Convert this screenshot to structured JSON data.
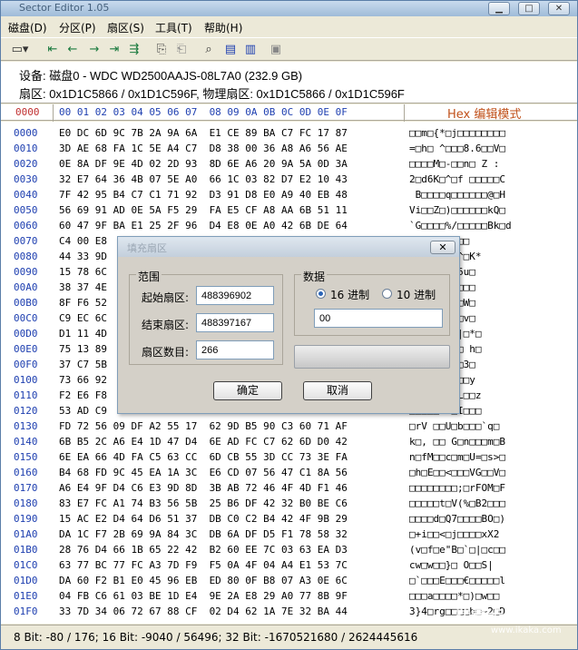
{
  "window": {
    "title": "Sector Editor 1.05",
    "min": "▁",
    "max": "□",
    "close": "✕"
  },
  "menu": [
    "磁盘(D)",
    "分区(P)",
    "扇区(S)",
    "工具(T)",
    "帮助(H)"
  ],
  "toolbar_icons": [
    "drive-icon",
    "first-icon",
    "prev-icon",
    "next-icon",
    "last-icon",
    "goto-icon",
    "copy-icon",
    "paste-icon",
    "search-icon",
    "fill-icon",
    "export-icon",
    "save-icon"
  ],
  "info": {
    "line1": "设备: 磁盘0 - WDC WD2500AAJS-08L7A0 (232.9 GB)",
    "line2": "扇区: 0x1D1C5866 / 0x1D1C596F,  物理扇区: 0x1D1C5866 / 0x1D1C596F"
  },
  "hex_header": {
    "offset": "0000",
    "cols": "00 01 02 03 04 05 06 07  08 09 0A 0B 0C 0D 0E 0F",
    "ascii_title": "Hex 编辑模式"
  },
  "offsets": [
    "0000",
    "0010",
    "0020",
    "0030",
    "0040",
    "0050",
    "0060",
    "0070",
    "0080",
    "0090",
    "00A0",
    "00B0",
    "00C0",
    "00D0",
    "00E0",
    "00F0",
    "0100",
    "0110",
    "0120",
    "0130",
    "0140",
    "0150",
    "0160",
    "0170",
    "0180",
    "0190",
    "01A0",
    "01B0",
    "01C0",
    "01D0",
    "01E0",
    "01F0"
  ],
  "hex_rows": [
    "E0 DC 6D 9C 7B 2A 9A 6A  E1 CE 89 BA C7 FC 17 87",
    "3D AE 68 FA 1C 5E A4 C7  D8 38 00 36 A8 A6 56 AE",
    "0E 8A DF 9E 4D 02 2D 93  8D 6E A6 20 9A 5A 0D 3A",
    "32 E7 64 36 4B 07 5E A0  66 1C 03 82 D7 E2 10 43",
    "7F 42 95 B4 C7 C1 71 92  D3 91 D8 E0 A9 40 EB 48",
    "56 69 91 AD 0E 5A F5 29  FA E5 CF A8 AA 6B 51 11",
    "60 47 9F BA E1 25 2F 96  D4 E8 0E A0 42 6B DE 64",
    "C4 00 E8",
    "44 33 9D",
    "15 78 6C",
    "38 37 4E",
    "8F F6 52",
    "C9 EC 6C",
    "D1 11 4D",
    "75 13 89",
    "37 C7 5B",
    "73 66 92",
    "F2 E6 F8",
    "53 AD C9",
    "FD 72 56 09 DF A2 55 17  62 9D B5 90 C3 60 71 AF",
    "6B B5 2C A6 E4 1D 47 D4  6E AD FC C7 62 6D D0 42",
    "6E EA 66 4D FA C5 63 CC  6D CB 55 3D CC 73 3E FA",
    "B4 68 FD 9C 45 EA 1A 3C  E6 CD 07 56 47 C1 8A 56",
    "A6 E4 9F D4 C6 E3 9D 8D  3B AB 72 46 4F 4D F1 46",
    "83 E7 FC A1 74 B3 56 5B  25 B6 DF 42 32 B0 BE C6",
    "15 AC E2 D4 64 D6 51 37  DB C0 C2 B4 42 4F 9B 29",
    "DA 1C F7 2B 69 9A 84 3C  DB 6A DF D5 F1 78 58 32",
    "28 76 D4 66 1B 65 22 42  B2 60 EE 7C 03 63 EA D3",
    "63 77 BC 77 FC A3 7D F9  F5 0A 4F 04 A4 E1 53 7C",
    "DA 60 F2 B1 E0 45 96 EB  ED 80 0F B8 07 A3 0E 6C",
    "04 FB C6 61 03 BE 1D E4  9E 2A E8 29 A0 77 8B 9F",
    "33 7D 34 06 72 67 88 CF  02 D4 62 1A 7E 32 BA 44"
  ],
  "ascii_rows": [
    "□□m□{*□j□□□□□□□□",
    "=□h□ ^□□□8.6□□V□",
    "□□□□M□-□□n□ Z :",
    "2□d6K□^□f □□□□□C",
    " B□□□□q□□□□□□@□H",
    "Vi□□Z□)□□□□□□kQ□",
    "`G□□□□%/□□□□□Bk□d",
    "Hil□□□>u□□",
    "3□BkUKe□^□K*",
    "a□□□$□.□6u□",
    "□!YJ□)□□□□□",
    "□□□□□□□□□W□",
    "□□M□ □$□□v□",
    "□□VMUzH |□*□",
    "□$VW □2i□ h□",
    "□□(□?□□□□3□",
    "□□G□□□□*□□y",
    "□□0□□s>]L□□z",
    "□□□□□6.□I□□□",
    "□rV □□U□b□□□`q□",
    "k□, □□ G□n□□□m□B",
    "n□fM□□c□m□U=□s>□",
    "□h□E□□<□□□VG□□V□",
    "□□□□□□□□;□rFOM□F",
    "□□□□□t□V(%□B2□□□",
    "□□□□d□Q7□□□□BO□)",
    "□+i□□<□j□□□□xX2",
    "(v□f□e\"B□`□|□c□□",
    "cw□w□□}□ O□□S|",
    "□`□□□E□□□€□□□□□l",
    "□□□a□□□□*□)□w□□",
    "3}4□rg□□□□b□~2□D"
  ],
  "status": "8 Bit: -80 / 176;  16 Bit: -9040 / 56496;  32 Bit: -1670521680 / 2624445616",
  "dialog": {
    "title": "填充扇区",
    "close": "✕",
    "range_label": "范围",
    "start_label": "起始扇区:",
    "start_value": "488396902",
    "end_label": "结束扇区:",
    "end_value": "488397167",
    "count_label": "扇区数目:",
    "count_value": "266",
    "data_label": "数据",
    "radio_hex": "16 进制",
    "radio_dec": "10 进制",
    "data_value": "00",
    "ok": "确定",
    "cancel": "取消"
  },
  "watermark": {
    "text": "揣着卡卡",
    "url": "www.ikaka.com"
  }
}
